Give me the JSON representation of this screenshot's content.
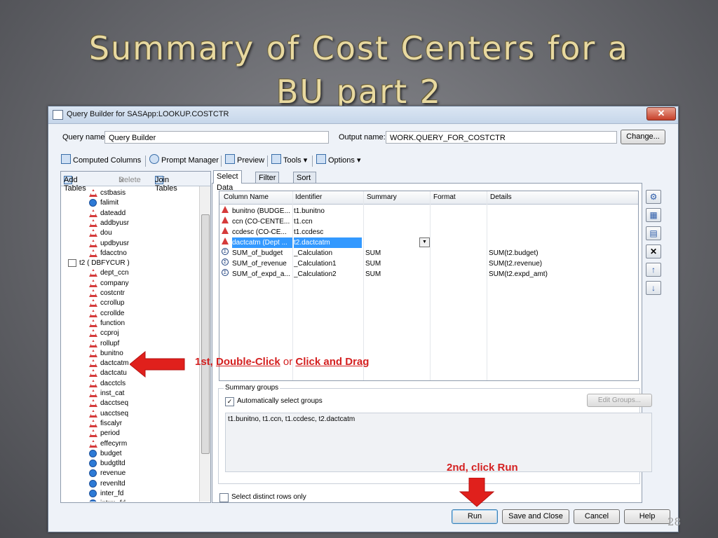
{
  "slide": {
    "title_line1": "Summary of Cost Centers for a",
    "title_line2": "BU part 2",
    "page_number": "28"
  },
  "window": {
    "title": "Query Builder for SASApp:LOOKUP.COSTCTR",
    "close_glyph": "✕",
    "query_name_label": "Query name:",
    "query_name_value": "Query Builder",
    "output_name_label": "Output name:",
    "output_name_value": "WORK.QUERY_FOR_COSTCTR",
    "change_button": "Change..."
  },
  "toolbar": {
    "computed_columns": "Computed Columns",
    "prompt_manager": "Prompt Manager",
    "preview": "Preview",
    "tools": "Tools",
    "options": "Options"
  },
  "left_pane": {
    "add_tables": "Add Tables",
    "delete": "Delete",
    "join_tables": "Join Tables",
    "tree_items": [
      {
        "label": "cstbasis",
        "type": "char"
      },
      {
        "label": "falimit",
        "type": "num"
      },
      {
        "label": "dateadd",
        "type": "char"
      },
      {
        "label": "addbyusr",
        "type": "char"
      },
      {
        "label": "dou",
        "type": "char"
      },
      {
        "label": "updbyusr",
        "type": "char"
      },
      {
        "label": "fdacctno",
        "type": "char"
      },
      {
        "label": "t2 ( DBFYCUR )",
        "type": "table"
      },
      {
        "label": "dept_ccn",
        "type": "char"
      },
      {
        "label": "company",
        "type": "char"
      },
      {
        "label": "costcntr",
        "type": "char"
      },
      {
        "label": "ccrollup",
        "type": "char"
      },
      {
        "label": "ccrollde",
        "type": "char"
      },
      {
        "label": "function",
        "type": "char"
      },
      {
        "label": "ccproj",
        "type": "char"
      },
      {
        "label": "rollupf",
        "type": "char"
      },
      {
        "label": "bunitno",
        "type": "char"
      },
      {
        "label": "dactcatm",
        "type": "char"
      },
      {
        "label": "dactcatu",
        "type": "char"
      },
      {
        "label": "dacctcls",
        "type": "char"
      },
      {
        "label": "inst_cat",
        "type": "char"
      },
      {
        "label": "dacctseq",
        "type": "char"
      },
      {
        "label": "uacctseq",
        "type": "char"
      },
      {
        "label": "fiscalyr",
        "type": "char"
      },
      {
        "label": "period",
        "type": "char"
      },
      {
        "label": "effecyrm",
        "type": "char"
      },
      {
        "label": "budget",
        "type": "num"
      },
      {
        "label": "budgtltd",
        "type": "num"
      },
      {
        "label": "revenue",
        "type": "num"
      },
      {
        "label": "revenltd",
        "type": "num"
      },
      {
        "label": "inter_fd",
        "type": "num"
      },
      {
        "label": "intrm_fd",
        "type": "num"
      }
    ]
  },
  "tabs": [
    "Select Data",
    "Filter Data",
    "Sort Data"
  ],
  "grid": {
    "headers": [
      "Column Name",
      "Identifier",
      "Summary",
      "Format",
      "Details"
    ],
    "rows": [
      {
        "icon": "char",
        "name": "bunitno (BUDGE...",
        "identifier": "t1.bunitno",
        "summary": "",
        "format": "",
        "details": ""
      },
      {
        "icon": "char",
        "name": "ccn (CO-CENTE...",
        "identifier": "t1.ccn",
        "summary": "",
        "format": "",
        "details": ""
      },
      {
        "icon": "char",
        "name": "ccdesc (CO-CE...",
        "identifier": "t1.ccdesc",
        "summary": "",
        "format": "",
        "details": ""
      },
      {
        "icon": "char",
        "name": "dactcatm (Dept ...",
        "identifier": "t2.dactcatm",
        "summary": "",
        "format": "",
        "details": ""
      },
      {
        "icon": "calc",
        "name": "SUM_of_budget",
        "identifier": "_Calculation",
        "summary": "SUM",
        "format": "",
        "details": "SUM(t2.budget)"
      },
      {
        "icon": "calc",
        "name": "SUM_of_revenue",
        "identifier": "_Calculation1",
        "summary": "SUM",
        "format": "",
        "details": "SUM(t2.revenue)"
      },
      {
        "icon": "calc",
        "name": "SUM_of_expd_a...",
        "identifier": "_Calculation2",
        "summary": "SUM",
        "format": "",
        "details": "SUM(t2.expd_amt)"
      }
    ]
  },
  "summary_groups": {
    "title": "Summary groups",
    "auto_select_label": "Automatically select groups",
    "auto_select_checked": "✓",
    "edit_groups": "Edit Groups...",
    "groups_text": "t1.bunitno, t1.ccn, t1.ccdesc, t2.dactcatm"
  },
  "distinct_rows_label": "Select distinct rows only",
  "bottom_buttons": {
    "run": "Run",
    "save_close": "Save and Close",
    "cancel": "Cancel",
    "help": "Help"
  },
  "annotations": {
    "step1_prefix": "1st, ",
    "step1_double_click": "Double-Click",
    "step1_or": " or ",
    "step1_click_drag": "Click and Drag",
    "step2": "2nd, click Run"
  },
  "colors": {
    "accent_red": "#d42020",
    "selection_blue": "#3399ff",
    "title_gold": "#e8d9a0"
  }
}
